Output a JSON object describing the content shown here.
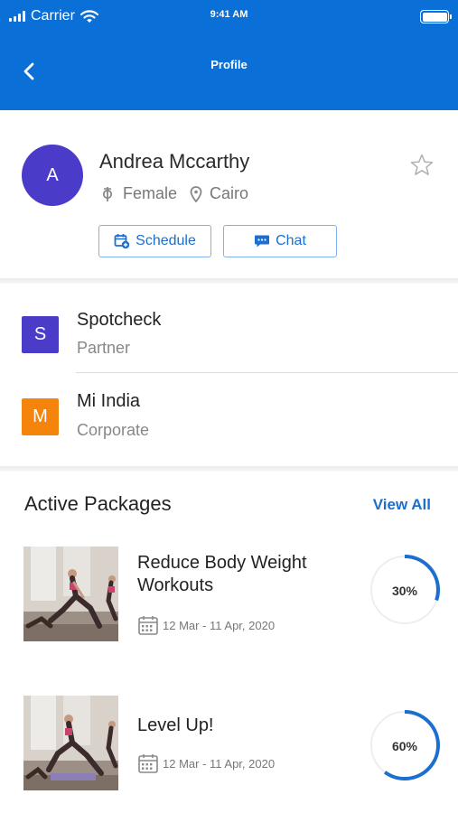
{
  "status_bar": {
    "carrier": "Carrier",
    "time": "9:41 AM"
  },
  "nav": {
    "title": "Profile",
    "back_icon": "chevron-left-icon"
  },
  "profile": {
    "avatar_initial": "A",
    "avatar_color": "#4a3bc9",
    "name": "Andrea Mccarthy",
    "gender": "Female",
    "location": "Cairo",
    "schedule_label": "Schedule",
    "chat_label": "Chat"
  },
  "organizations": [
    {
      "initial": "S",
      "name": "Spotcheck",
      "type": "Partner",
      "color": "#4a3bc9"
    },
    {
      "initial": "M",
      "name": "Mi India",
      "type": "Corporate",
      "color": "#f5840c"
    }
  ],
  "packages_section": {
    "title": "Active Packages",
    "view_all": "View All"
  },
  "packages": [
    {
      "title": "Reduce Body Weight Workouts",
      "dates": "12 Mar - 11 Apr, 2020",
      "progress_label": "30%",
      "progress": 0.3
    },
    {
      "title": "Level Up!",
      "dates": "12 Mar - 11 Apr, 2020",
      "progress_label": "60%",
      "progress": 0.6
    }
  ],
  "colors": {
    "primary": "#0a6fd6",
    "link": "#1a6fd0",
    "ring": "#1a6fd0"
  }
}
